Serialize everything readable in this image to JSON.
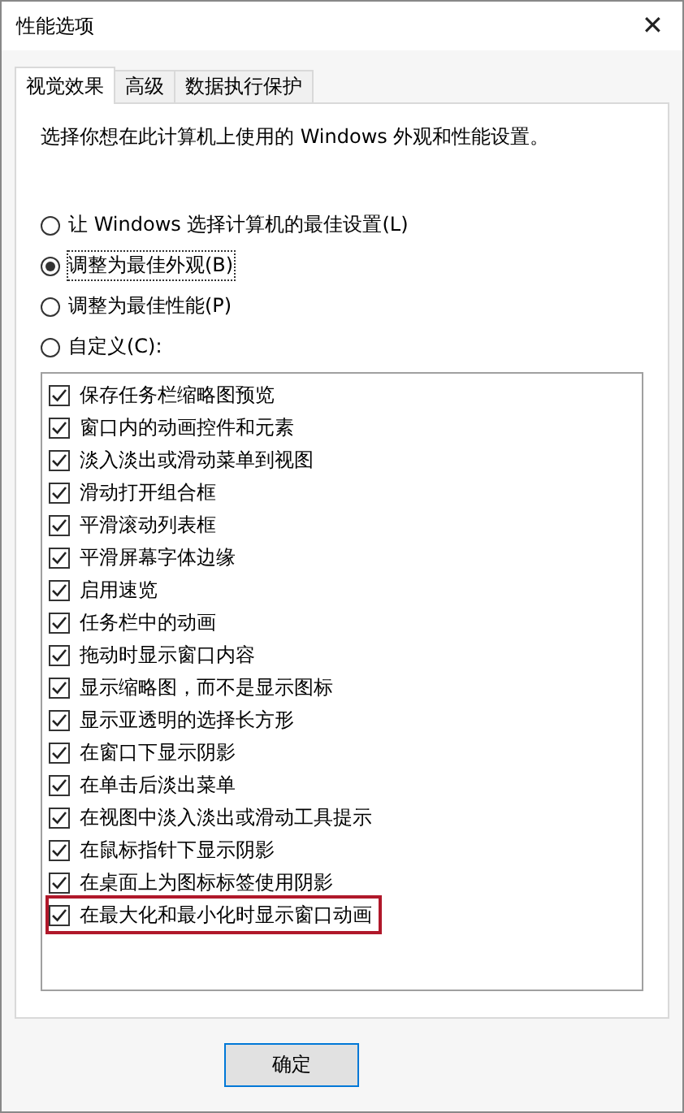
{
  "window": {
    "title": "性能选项",
    "close": "✕"
  },
  "tabs": [
    {
      "label": "视觉效果",
      "selected": true
    },
    {
      "label": "高级",
      "selected": false
    },
    {
      "label": "数据执行保护",
      "selected": false
    }
  ],
  "description": "选择你想在此计算机上使用的 Windows 外观和性能设置。",
  "options": [
    {
      "label": "让 Windows 选择计算机的最佳设置(L)",
      "selected": false
    },
    {
      "label": "调整为最佳外观(B)",
      "selected": true
    },
    {
      "label": "调整为最佳性能(P)",
      "selected": false
    },
    {
      "label": "自定义(C):",
      "selected": false
    }
  ],
  "effects": [
    {
      "label": "保存任务栏缩略图预览",
      "checked": true,
      "highlighted": false
    },
    {
      "label": "窗口内的动画控件和元素",
      "checked": true,
      "highlighted": false
    },
    {
      "label": "淡入淡出或滑动菜单到视图",
      "checked": true,
      "highlighted": false
    },
    {
      "label": "滑动打开组合框",
      "checked": true,
      "highlighted": false
    },
    {
      "label": "平滑滚动列表框",
      "checked": true,
      "highlighted": false
    },
    {
      "label": "平滑屏幕字体边缘",
      "checked": true,
      "highlighted": false
    },
    {
      "label": "启用速览",
      "checked": true,
      "highlighted": false
    },
    {
      "label": "任务栏中的动画",
      "checked": true,
      "highlighted": false
    },
    {
      "label": "拖动时显示窗口内容",
      "checked": true,
      "highlighted": false
    },
    {
      "label": "显示缩略图，而不是显示图标",
      "checked": true,
      "highlighted": false
    },
    {
      "label": "显示亚透明的选择长方形",
      "checked": true,
      "highlighted": false
    },
    {
      "label": "在窗口下显示阴影",
      "checked": true,
      "highlighted": false
    },
    {
      "label": "在单击后淡出菜单",
      "checked": true,
      "highlighted": false
    },
    {
      "label": "在视图中淡入淡出或滑动工具提示",
      "checked": true,
      "highlighted": false
    },
    {
      "label": "在鼠标指针下显示阴影",
      "checked": true,
      "highlighted": false
    },
    {
      "label": "在桌面上为图标标签使用阴影",
      "checked": true,
      "highlighted": false
    },
    {
      "label": "在最大化和最小化时显示窗口动画",
      "checked": true,
      "highlighted": true
    }
  ],
  "buttons": [
    "确定"
  ]
}
